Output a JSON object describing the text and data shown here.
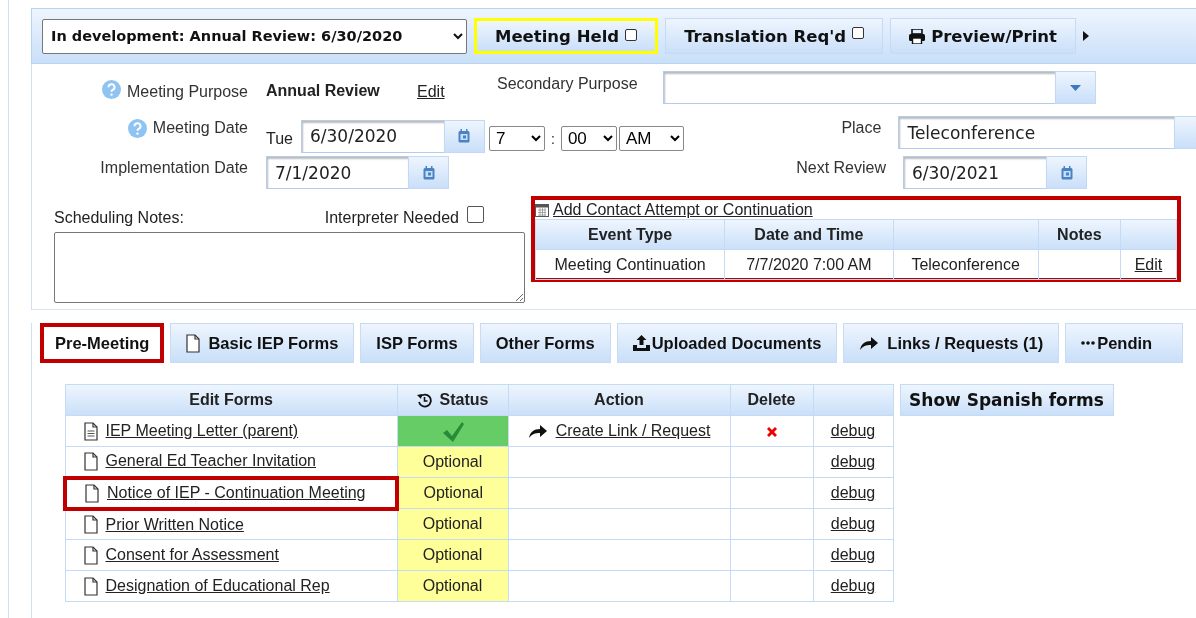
{
  "record_select": {
    "value": "In development: Annual Review: 6/30/2020"
  },
  "toolbar": [
    {
      "kind": "toggle",
      "label": "Meeting Held",
      "checked": false,
      "highlighted": true
    },
    {
      "kind": "toggle",
      "label": "Translation Req'd",
      "checked": false,
      "highlighted": false
    },
    {
      "kind": "print",
      "label": "Preview/Print",
      "highlighted": false
    }
  ],
  "meeting_purpose": {
    "label": "Meeting Purpose",
    "value": "Annual Review",
    "edit": "Edit"
  },
  "secondary_purpose": {
    "label": "Secondary Purpose"
  },
  "meeting_date": {
    "label": "Meeting Date",
    "weekday": "Tue",
    "date": "6/30/2020",
    "hour": "7",
    "separator": ":",
    "minute": "00",
    "ampm": "AM"
  },
  "place": {
    "label": "Place",
    "value": "Teleconference"
  },
  "implementation_date": {
    "label": "Implementation Date",
    "date": "7/1/2020"
  },
  "next_review": {
    "label": "Next Review",
    "date": "6/30/2021"
  },
  "scheduling_notes": {
    "label": "Scheduling Notes:"
  },
  "interpreter": {
    "label": "Interpreter Needed",
    "checked": false
  },
  "contacts": {
    "highlighted": true,
    "add_link": "Add Contact Attempt or Continuation",
    "header": {
      "event_type": "Event Type",
      "date_time": "Date and Time",
      "notes": "Notes"
    },
    "rows": [
      {
        "event_type": "Meeting Continuation",
        "date_time": "7/7/2020 7:00 AM",
        "place": "Teleconference",
        "action": "Edit"
      }
    ]
  },
  "tabs": [
    {
      "label": "Pre-Meeting",
      "kind": "plain",
      "selected": true,
      "highlighted": true
    },
    {
      "label": "Basic IEP Forms",
      "kind": "document",
      "selected": false,
      "highlighted": false
    },
    {
      "label": "ISP Forms",
      "kind": "plain",
      "selected": false,
      "highlighted": false
    },
    {
      "label": "Other Forms",
      "kind": "plain",
      "selected": false,
      "highlighted": false
    },
    {
      "label": "Uploaded Documents",
      "kind": "upload",
      "selected": false,
      "highlighted": false
    },
    {
      "label": "Links / Requests (1)",
      "kind": "share",
      "selected": false,
      "highlighted": false
    },
    {
      "label": "Pendin",
      "kind": "more",
      "selected": false,
      "highlighted": false
    }
  ],
  "forms_table": {
    "columns": {
      "form": "Edit Forms",
      "status": "Status",
      "action": "Action",
      "delete": "Delete"
    },
    "rows": [
      {
        "kind": "letter",
        "name": "IEP Meeting Letter (parent)",
        "completed": true,
        "action": "Create Link / Request",
        "deletable": true,
        "debug": "debug",
        "highlighted": false
      },
      {
        "kind": "blank",
        "name": "General Ed Teacher Invitation",
        "completed": false,
        "status_text": "Optional",
        "deletable": false,
        "debug": "debug",
        "highlighted": false
      },
      {
        "kind": "blank",
        "name": "Notice of IEP - Continuation Meeting",
        "completed": false,
        "status_text": "Optional",
        "deletable": false,
        "debug": "debug",
        "highlighted": true
      },
      {
        "kind": "blank",
        "name": "Prior Written Notice",
        "completed": false,
        "status_text": "Optional",
        "deletable": false,
        "debug": "debug",
        "highlighted": false
      },
      {
        "kind": "blank",
        "name": "Consent for Assessment",
        "completed": false,
        "status_text": "Optional",
        "deletable": false,
        "debug": "debug",
        "highlighted": false
      },
      {
        "kind": "blank",
        "name": "Designation of Educational Rep",
        "completed": false,
        "status_text": "Optional",
        "deletable": false,
        "debug": "debug",
        "highlighted": false
      }
    ]
  },
  "show_spanish": "Show Spanish forms"
}
